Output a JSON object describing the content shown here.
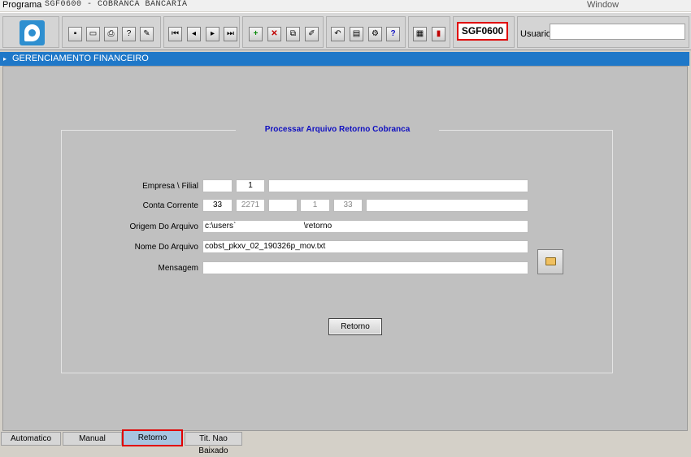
{
  "menubar": {
    "program": "Programa",
    "title": "SGF0600 - COBRANCA BANCARIA",
    "window": "Window"
  },
  "toolbar": {
    "form_code": "SGF0600",
    "user_label": "Usuario",
    "user_value": ""
  },
  "window": {
    "title": "GERENCIAMENTO FINANCEIRO"
  },
  "form": {
    "section_title": "Processar Arquivo Retorno Cobranca",
    "empresa_label": "Empresa \\ Filial",
    "empresa_value": "",
    "filial_value": "1",
    "conta_label": "Conta Corrente",
    "conta_values": [
      "33",
      "2271",
      "",
      "1",
      "33",
      ""
    ],
    "origem_label": "Origem Do Arquivo",
    "origem_value": "c:\\users`                              \\retorno",
    "nome_label": "Nome Do Arquivo",
    "nome_value": "cobst_pkxv_02_190326p_mov.txt",
    "mensagem_label": "Mensagem",
    "mensagem_value": "",
    "retorno_button": "Retorno"
  },
  "tabs": [
    {
      "label": "Automatico"
    },
    {
      "label": "Manual"
    },
    {
      "label": "Retorno",
      "active": true
    },
    {
      "label": "Tit. Nao Baixado"
    }
  ]
}
